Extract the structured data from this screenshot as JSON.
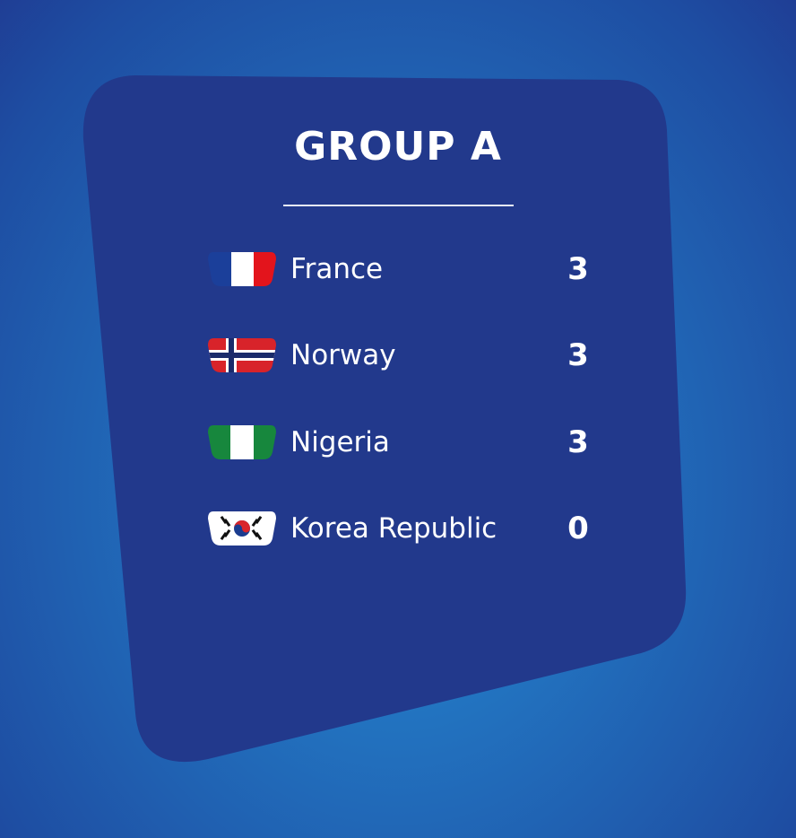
{
  "group": {
    "title": "GROUP A"
  },
  "colors": {
    "background": "#2272bf",
    "card": "#22398c",
    "text": "#ffffff"
  },
  "standings": [
    {
      "team": "France",
      "points": "3",
      "flag": "france-flag-icon"
    },
    {
      "team": "Norway",
      "points": "3",
      "flag": "norway-flag-icon"
    },
    {
      "team": "Nigeria",
      "points": "3",
      "flag": "nigeria-flag-icon"
    },
    {
      "team": "Korea Republic",
      "points": "0",
      "flag": "korea-republic-flag-icon"
    }
  ]
}
